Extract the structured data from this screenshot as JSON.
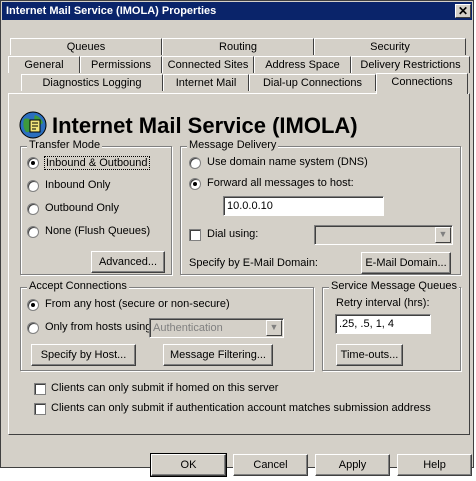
{
  "window": {
    "title": "Internet Mail Service (IMOLA) Properties",
    "close_glyph": "✕"
  },
  "tabs": {
    "row1": [
      "Queues",
      "Routing",
      "Security"
    ],
    "row2": [
      "General",
      "Permissions",
      "Connected Sites",
      "Address Space",
      "Delivery Restrictions"
    ],
    "row3": [
      "Diagnostics Logging",
      "Internet Mail",
      "Dial-up Connections",
      "Connections"
    ],
    "active": "Connections"
  },
  "page": {
    "heading": "Internet Mail Service (IMOLA)",
    "icon": "globe-mail-icon"
  },
  "transfer_mode": {
    "label": "Transfer Mode",
    "options": [
      "Inbound & Outbound",
      "Inbound Only",
      "Outbound Only",
      "None (Flush Queues)"
    ],
    "selected": "Inbound & Outbound",
    "advanced_button": "Advanced..."
  },
  "message_delivery": {
    "label": "Message Delivery",
    "option_dns": "Use domain name system (DNS)",
    "option_forward": "Forward all messages to host:",
    "selected": "Forward all messages to host:",
    "host_value": "10.0.0.10",
    "dial_using_label": "Dial using:",
    "dial_using_value": "",
    "dial_using_checked": false,
    "specify_label": "Specify by E-Mail Domain:",
    "email_domain_button": "E-Mail Domain..."
  },
  "accept_connections": {
    "label": "Accept Connections",
    "option_any": "From any host (secure or non-secure)",
    "option_only": "Only from hosts using:",
    "selected": "From any host (secure or non-secure)",
    "only_value": "Authentication",
    "specify_host_button": "Specify by Host...",
    "message_filtering_button": "Message Filtering..."
  },
  "service_queues": {
    "label": "Service Message Queues",
    "retry_label": "Retry interval (hrs):",
    "retry_value": ".25, .5, 1, 4",
    "timeouts_button": "Time-outs..."
  },
  "checkboxes": {
    "homed": {
      "label": "Clients can only submit if homed on this server",
      "checked": false
    },
    "auth": {
      "label": "Clients can only submit if authentication account matches submission address",
      "checked": false
    }
  },
  "footer": {
    "ok": "OK",
    "cancel": "Cancel",
    "apply": "Apply",
    "help": "Help"
  },
  "colors": {
    "titlebar": "#0a246a",
    "face": "#d4d0c8"
  }
}
